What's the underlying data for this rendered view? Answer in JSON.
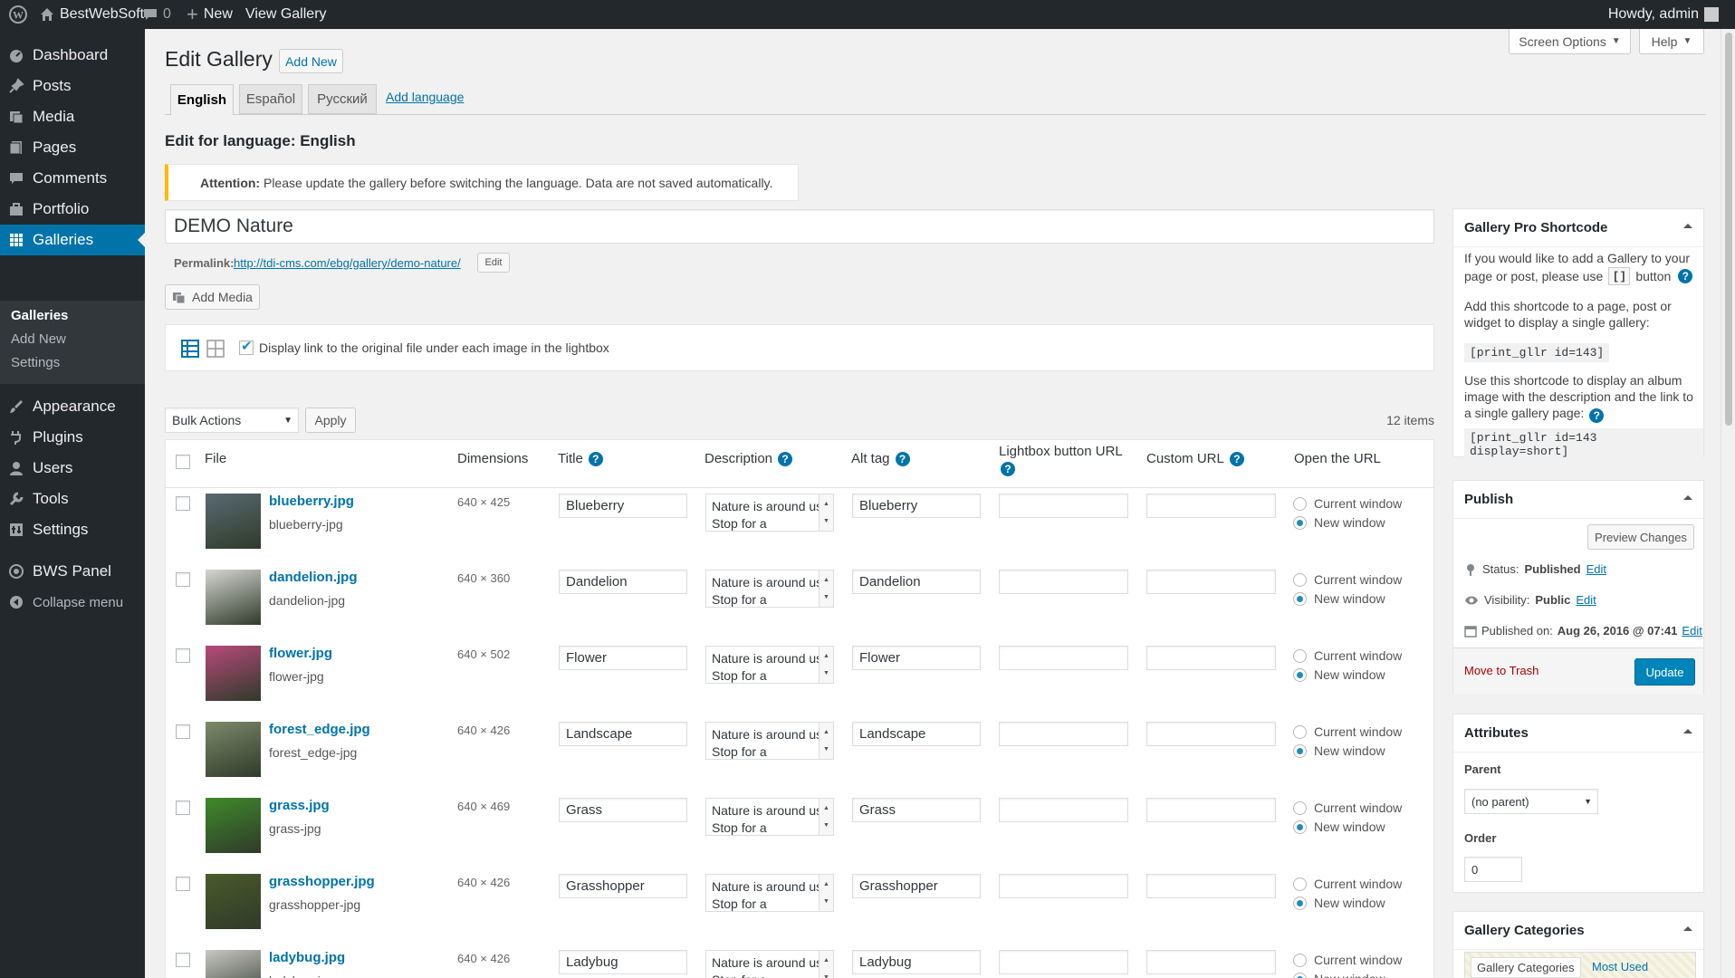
{
  "adminbar": {
    "site": "BestWebSoft",
    "comments": "0",
    "new": "New",
    "view": "View Gallery",
    "howdy": "Howdy, admin"
  },
  "sidebar": {
    "items": [
      {
        "label": "Dashboard",
        "icon": "dashboard-icon"
      },
      {
        "label": "Posts",
        "icon": "pin-icon"
      },
      {
        "label": "Media",
        "icon": "media-icon"
      },
      {
        "label": "Pages",
        "icon": "page-icon"
      },
      {
        "label": "Comments",
        "icon": "comment-icon"
      },
      {
        "label": "Portfolio",
        "icon": "portfolio-icon"
      },
      {
        "label": "Galleries",
        "icon": "grid-icon"
      },
      {
        "label": "Appearance",
        "icon": "brush-icon"
      },
      {
        "label": "Plugins",
        "icon": "plugin-icon"
      },
      {
        "label": "Users",
        "icon": "user-icon"
      },
      {
        "label": "Tools",
        "icon": "wrench-icon"
      },
      {
        "label": "Settings",
        "icon": "settings-icon"
      },
      {
        "label": "BWS Panel",
        "icon": "bws-icon"
      },
      {
        "label": "Collapse menu",
        "icon": "collapse-icon"
      }
    ],
    "submenu": [
      "Galleries",
      "Add New",
      "Settings"
    ]
  },
  "header": {
    "title": "Edit Gallery",
    "add_new": "Add New",
    "screen_options": "Screen Options",
    "help": "Help"
  },
  "tabs": [
    "English",
    "Español",
    "Русский"
  ],
  "add_language": "Add language",
  "edit_for": "Edit for language: English",
  "notice": {
    "strong": "Attention:",
    "text": "Please update the gallery before switching the language. Data are not saved automatically."
  },
  "gallery_title": "DEMO Nature",
  "permalink": {
    "label": "Permalink:",
    "url": "http://tdi-cms.com/ebg/gallery/demo-nature/",
    "edit": "Edit"
  },
  "add_media": "Add Media",
  "display_link_label": "Display link to the original file under each image in the lightbox",
  "bulk": {
    "select": "Bulk Actions",
    "apply": "Apply",
    "count": "12 items"
  },
  "columns": {
    "file": "File",
    "dimensions": "Dimensions",
    "title": "Title",
    "description": "Description",
    "alt": "Alt tag",
    "lightbox": "Lightbox button URL",
    "custom": "Custom URL",
    "open": "Open the URL"
  },
  "radio_labels": {
    "current": "Current window",
    "new": "New window"
  },
  "rows": [
    {
      "file": "blueberry.jpg",
      "slug": "blueberry-jpg",
      "dim": "640 × 425",
      "title": "Blueberry",
      "desc": "Nature is around us. Stop for a",
      "alt": "Blueberry",
      "thumb": "#5a6a72"
    },
    {
      "file": "dandelion.jpg",
      "slug": "dandelion-jpg",
      "dim": "640 × 360",
      "title": "Dandelion",
      "desc": "Nature is around us. Stop for a",
      "alt": "Dandelion",
      "thumb": "#d6d6d2"
    },
    {
      "file": "flower.jpg",
      "slug": "flower-jpg",
      "dim": "640 × 502",
      "title": "Flower",
      "desc": "Nature is around us. Stop for a",
      "alt": "Flower",
      "thumb": "#b84a7a"
    },
    {
      "file": "forest_edge.jpg",
      "slug": "forest_edge-jpg",
      "dim": "640 × 426",
      "title": "Landscape",
      "desc": "Nature is around us. Stop for a",
      "alt": "Landscape",
      "thumb": "#7d8a6a"
    },
    {
      "file": "grass.jpg",
      "slug": "grass-jpg",
      "dim": "640 × 469",
      "title": "Grass",
      "desc": "Nature is around us. Stop for a",
      "alt": "Grass",
      "thumb": "#3f8a2a"
    },
    {
      "file": "grasshopper.jpg",
      "slug": "grasshopper-jpg",
      "dim": "640 × 426",
      "title": "Grasshopper",
      "desc": "Nature is around us. Stop for a",
      "alt": "Grasshopper",
      "thumb": "#4a5a2a"
    },
    {
      "file": "ladybug.jpg",
      "slug": "ladybug-jpg",
      "dim": "640 × 426",
      "title": "Ladybug",
      "desc": "Nature is around us. Stop for a",
      "alt": "Ladybug",
      "thumb": "#c9c7c4"
    }
  ],
  "shortcode_box": {
    "title": "Gallery Pro Shortcode",
    "text1a": "If you would like to add a Gallery to your",
    "text1b": "page or post, please use",
    "text1c": "button",
    "text2": "Add this shortcode to a page, post or widget to display a single gallery:",
    "code1": "[print_gllr id=143]",
    "text3": "Use this shortcode to display an album image with the description and the link to a single gallery page:",
    "code2": "[print_gllr id=143 display=short]"
  },
  "publish": {
    "title": "Publish",
    "preview": "Preview Changes",
    "status_label": "Status:",
    "status": "Published",
    "visibility_label": "Visibility:",
    "visibility": "Public",
    "published_label": "Published on:",
    "published": "Aug 26, 2016 @ 07:41",
    "edit": "Edit",
    "trash": "Move to Trash",
    "update": "Update"
  },
  "attributes": {
    "title": "Attributes",
    "parent_label": "Parent",
    "parent": "(no parent)",
    "order_label": "Order",
    "order": "0"
  },
  "categories": {
    "title": "Gallery Categories",
    "tab1": "Gallery Categories",
    "tab2": "Most Used"
  }
}
